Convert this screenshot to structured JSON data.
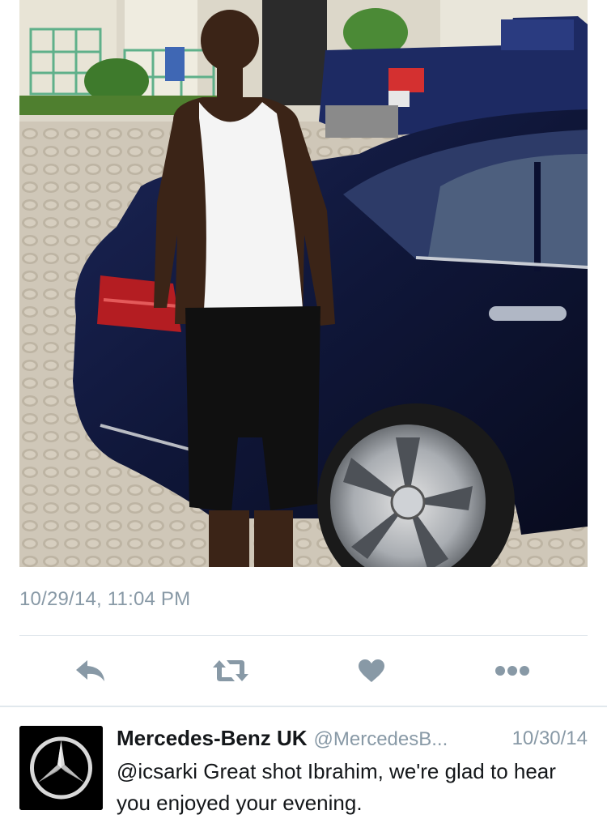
{
  "tweet": {
    "timestamp": "10/29/14, 11:04 PM",
    "actions": {
      "reply": "reply-icon",
      "retweet": "retweet-icon",
      "favorite": "heart-icon",
      "more": "more-icon"
    },
    "colors": {
      "meta_text": "#8899a6",
      "icon": "#8899a6",
      "divider": "#e1e8ed"
    }
  },
  "reply": {
    "name": "Mercedes-Benz UK",
    "handle": "@MercedesB...",
    "date": "10/30/14",
    "text": "@icsarki Great shot Ibrahim, we're glad to hear you enjoyed your evening.",
    "avatar_icon": "mercedes-star-logo"
  }
}
